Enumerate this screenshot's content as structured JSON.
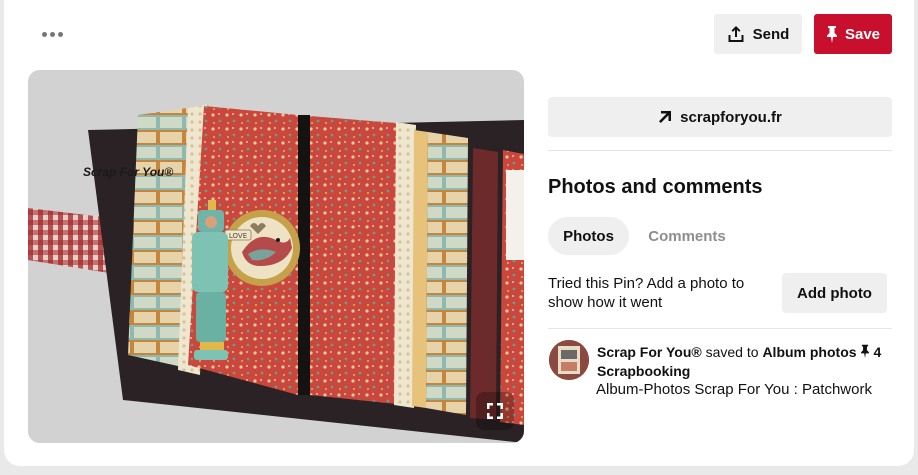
{
  "header": {
    "more_icon": "ellipsis-icon",
    "send_label": "Send",
    "send_icon": "share-upload-icon",
    "save_label": "Save",
    "save_icon": "pushpin-icon",
    "save_color": "#c8102e"
  },
  "pin": {
    "image_watermark": "Scrap For You®",
    "image_sticker_text": "LOVE",
    "expand_icon": "expand-icon"
  },
  "source": {
    "icon": "arrow-up-right-icon",
    "domain": "scrapforyou.fr"
  },
  "comments_section": {
    "title": "Photos and comments",
    "tabs": [
      {
        "label": "Photos",
        "active": true
      },
      {
        "label": "Comments",
        "active": false
      }
    ],
    "tried_prompt": "Tried this Pin? Add a photo to show how it went",
    "add_photo_label": "Add photo"
  },
  "activity": {
    "user": "Scrap For You®",
    "action": "saved to",
    "board": "Album photos",
    "board_icon": "pushpin-icon",
    "board_suffix": "4 Scrapbooking",
    "description": "Album-Photos Scrap For You : Patchwork"
  }
}
